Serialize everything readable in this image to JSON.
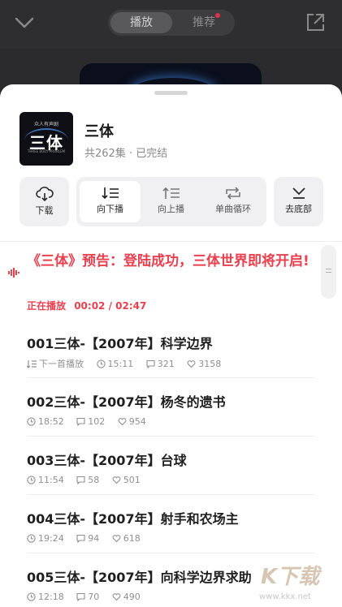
{
  "top_bar": {
    "tabs": [
      {
        "label": "播放",
        "active": true
      },
      {
        "label": "推荐",
        "active": false,
        "has_dot": true
      }
    ]
  },
  "album": {
    "cover_text_top": "众人有声剧",
    "cover_text_main": "三体",
    "cover_text_sub": "THREE BODY PROBLEM",
    "title": "三体",
    "meta": "共262集 · 已完结"
  },
  "actions": {
    "download": "下载",
    "order_down": "向下播",
    "order_up": "向上播",
    "single_loop": "单曲循环",
    "to_bottom": "去底部"
  },
  "now_playing": {
    "title": "《三体》预告：登陆成功，三体世界即将开启!",
    "status_label": "正在播放",
    "progress": "00:02 / 02:47"
  },
  "episodes": [
    {
      "title": "001三体-【2007年】科学边界",
      "next_label": "下一首播放",
      "duration": "15:11",
      "comments": "321",
      "likes": "3158"
    },
    {
      "title": "002三体-【2007年】杨冬的遗书",
      "duration": "18:52",
      "comments": "102",
      "likes": "954"
    },
    {
      "title": "003三体-【2007年】台球",
      "duration": "11:54",
      "comments": "58",
      "likes": "501"
    },
    {
      "title": "004三体-【2007年】射手和农场主",
      "duration": "19:24",
      "comments": "94",
      "likes": "618"
    },
    {
      "title": "005三体-【2007年】向科学边界求助",
      "duration": "12:18",
      "comments": "70",
      "likes": "490"
    }
  ],
  "watermark": {
    "text": "K下载",
    "url": "www.kkx.net"
  },
  "colors": {
    "accent": "#e8404f",
    "sheet_bg": "#ffffff",
    "backdrop": "#2e2e30"
  }
}
